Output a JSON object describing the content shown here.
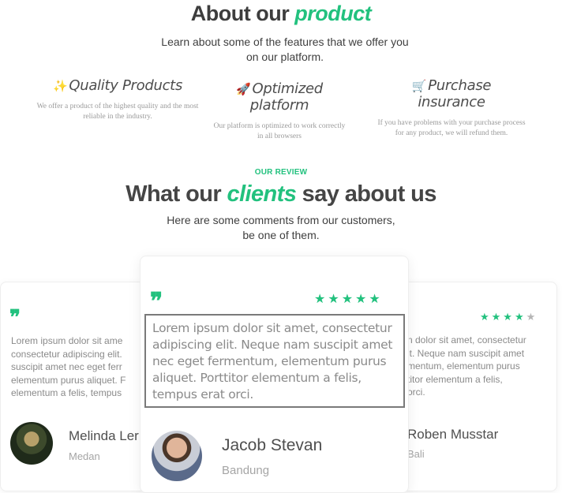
{
  "about": {
    "title_prefix": "About our ",
    "title_accent": "product",
    "subtitle": "Learn about some of the features that we offer you on our platform."
  },
  "features": [
    {
      "emoji": "✨",
      "title": "Quality Products",
      "desc": "We offer a product of the highest quality and the most reliable in the industry."
    },
    {
      "emoji": "🚀",
      "title": "Optimized platform",
      "desc": "Our platform is optimized to work correctly in all browsers"
    },
    {
      "emoji": "🛒",
      "title": "Purchase insurance",
      "desc": "If you have problems with your purchase process for any product, we will refund them."
    }
  ],
  "review": {
    "kicker": "OUR REVIEW",
    "title_prefix": "What our ",
    "title_accent": "clients",
    "title_suffix": " say about us",
    "subtitle": "Here are some comments from our customers, be one of them."
  },
  "testimonials": [
    {
      "text_lines": [
        "Lorem ipsum dolor sit ame",
        "consectetur adipiscing elit.",
        "suscipit amet nec eget ferr",
        "elementum purus aliquet. F",
        "elementum a felis, tempus"
      ],
      "name": "Melinda Ler",
      "location": "Medan"
    },
    {
      "stars": "★★★★★",
      "text": "Lorem ipsum dolor sit amet, consectetur adipiscing elit. Neque nam suscipit amet nec eget fermentum, elementum purus aliquet. Porttitor elementum a felis, tempus erat orci.",
      "name": "Jacob Stevan",
      "location": "Bandung"
    },
    {
      "stars_on": "★★★★",
      "stars_off": "★",
      "text_lines": [
        "n dolor sit amet, consectetur",
        "it. Neque nam suscipit amet",
        "mentum, elementum purus",
        "titor elementum a felis,",
        "orci."
      ],
      "name": "Roben Musstar",
      "location": "Bali"
    }
  ],
  "colors": {
    "accent": "#22c17e",
    "heading": "#3d3d3d",
    "muted": "#8a8a8a"
  }
}
